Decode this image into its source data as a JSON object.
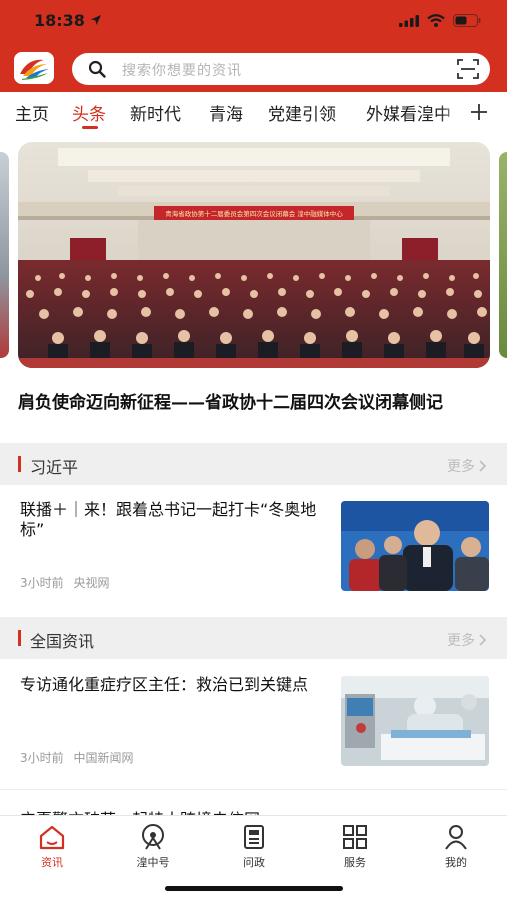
{
  "status_bar": {
    "time": "18:38"
  },
  "search": {
    "placeholder": "搜索你想要的资讯"
  },
  "tabs": [
    {
      "label": "主页"
    },
    {
      "label": "头条"
    },
    {
      "label": "新时代"
    },
    {
      "label": "青海"
    },
    {
      "label": "党建引领"
    },
    {
      "label": "外媒看湟中"
    }
  ],
  "active_tab": "头条",
  "banner": {
    "stage_banner_text": "青海省政协第十二届委员会第四次会议闭幕会 湟中融媒体中心",
    "headline": "肩负使命迈向新征程——省政协十二届四次会议闭幕侧记"
  },
  "sections": [
    {
      "title": "习近平",
      "more": "更多",
      "items": [
        {
          "title": "联播＋｜来！跟着总书记一起打卡“冬奥地标”",
          "time": "3小时前",
          "source": "央视网"
        }
      ]
    },
    {
      "title": "全国资讯",
      "more": "更多",
      "items": [
        {
          "title": "专访通化重症疗区主任：救治已到关键点",
          "time": "3小时前",
          "source": "中国新闻网"
        }
      ]
    }
  ],
  "cut_off_item": {
    "title": "宁夏警方破获一起特大跨境电信网"
  },
  "bottom_nav": [
    {
      "label": "资讯",
      "icon": "home-icon"
    },
    {
      "label": "湟中号",
      "icon": "broadcast-icon"
    },
    {
      "label": "问政",
      "icon": "document-icon"
    },
    {
      "label": "服务",
      "icon": "grid-icon"
    },
    {
      "label": "我的",
      "icon": "person-icon"
    }
  ],
  "colors": {
    "brand_red": "#d4301f"
  }
}
